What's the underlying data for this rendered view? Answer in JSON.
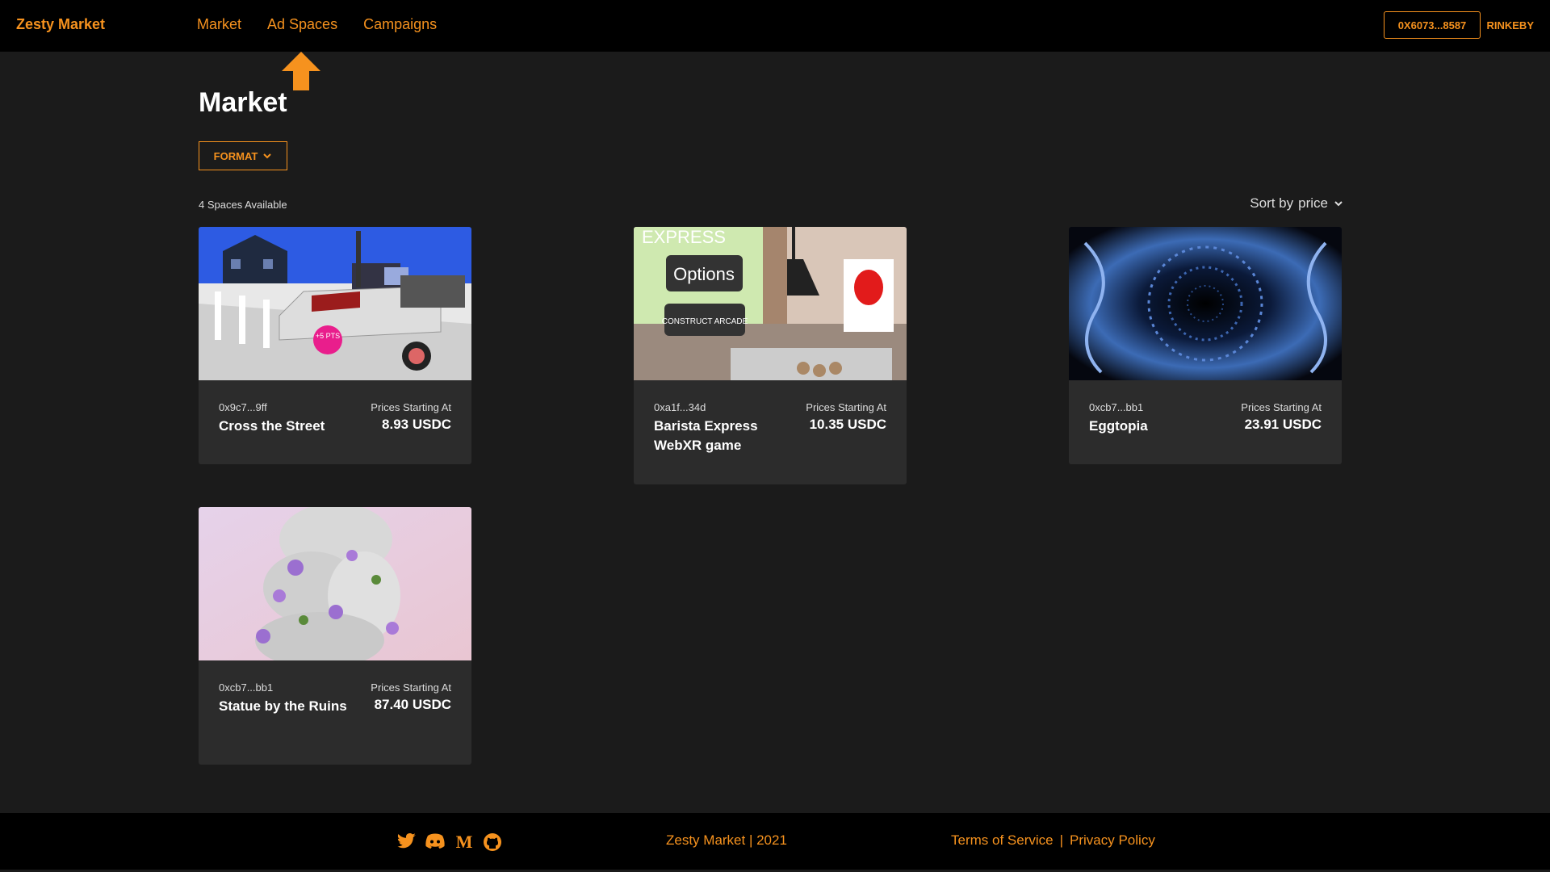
{
  "header": {
    "brand": "Zesty Market",
    "nav": [
      "Market",
      "Ad Spaces",
      "Campaigns"
    ],
    "wallet": "0X6073...8587",
    "network": "RINKEBY"
  },
  "main": {
    "title": "Market",
    "format_label": "FORMAT",
    "count_text": "4 Spaces Available",
    "sort_label": "Sort by",
    "sort_value": "price"
  },
  "cards": [
    {
      "addr": "0x9c7...9ff",
      "name": "Cross the Street",
      "price_label": "Prices Starting At",
      "price": "8.93 USDC"
    },
    {
      "addr": "0xa1f...34d",
      "name": "Barista Express WebXR game",
      "price_label": "Prices Starting At",
      "price": "10.35 USDC"
    },
    {
      "addr": "0xcb7...bb1",
      "name": "Eggtopia",
      "price_label": "Prices Starting At",
      "price": "23.91 USDC"
    },
    {
      "addr": "0xcb7...bb1",
      "name": "Statue by the Ruins",
      "price_label": "Prices Starting At",
      "price": "87.40 USDC"
    }
  ],
  "thumb_texts": {
    "options_sign": "Options",
    "arcade_sign": "CONSTRUCT ARCADE",
    "express_sign": "EXPRESS",
    "pts_badge": "+5 PTS"
  },
  "footer": {
    "copyright": "Zesty Market | 2021",
    "terms": "Terms of Service",
    "separator": "|",
    "privacy": "Privacy Policy"
  },
  "colors": {
    "accent": "#f6921e",
    "background": "#1b1b1b",
    "card": "#2c2c2c",
    "bar": "#000000"
  }
}
